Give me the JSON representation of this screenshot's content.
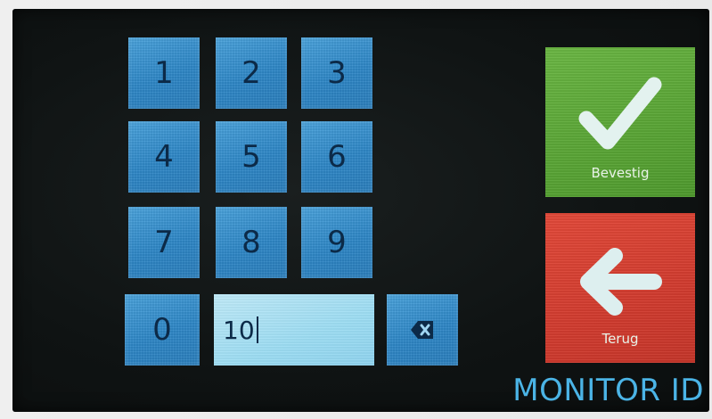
{
  "keypad": {
    "keys": [
      "1",
      "2",
      "3",
      "4",
      "5",
      "6",
      "7",
      "8",
      "9",
      "0"
    ]
  },
  "input": {
    "value": "10"
  },
  "buttons": {
    "confirm_label": "Bevestig",
    "back_label": "Terug",
    "backspace_icon": "backspace-icon",
    "confirm_icon": "checkmark-icon",
    "back_icon": "arrow-left-icon"
  },
  "screen": {
    "title": "MONITOR ID"
  },
  "colors": {
    "key_blue": "#2e87c7",
    "display_cyan": "#9cdcf2",
    "confirm_green": "#5aa536",
    "back_red": "#d23c2f",
    "title_blue": "#4bb4e6"
  }
}
